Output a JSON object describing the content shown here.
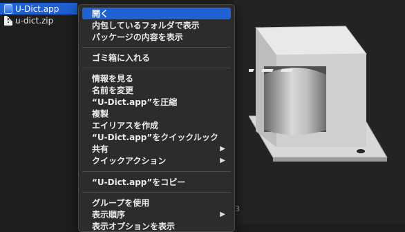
{
  "files": [
    {
      "name": "U-Dict.app",
      "icon": "app-icon",
      "selected": true
    },
    {
      "name": "u-dict.zip",
      "icon": "zip-icon",
      "selected": false
    }
  ],
  "menu": {
    "items": [
      {
        "label": "開く"
      },
      {
        "label": "内包しているフォルダで表示"
      },
      {
        "label": "パッケージの内容を表示"
      },
      {
        "label": "ゴミ箱に入れる"
      },
      {
        "label": "情報を見る"
      },
      {
        "label": "名前を変更"
      },
      {
        "label": "“U-Dict.app”を圧縮"
      },
      {
        "label": "複製"
      },
      {
        "label": "エイリアスを作成"
      },
      {
        "label": "“U-Dict.app”をクイックルック"
      },
      {
        "label": "共有",
        "submenu": "▶"
      },
      {
        "label": "クイックアクション",
        "submenu": "▶"
      },
      {
        "label": "“U-Dict.app”をコピー"
      },
      {
        "label": "グループを使用"
      },
      {
        "label": "表示順序",
        "submenu": "▶"
      },
      {
        "label": "表示オプションを表示"
      }
    ]
  },
  "preview": {
    "fragment": "3",
    "image": "transformer-icon"
  },
  "colors": {
    "selection": "#1e5fd2",
    "menu_bg": "#2c2c2e",
    "background": "#1e1e1e"
  }
}
